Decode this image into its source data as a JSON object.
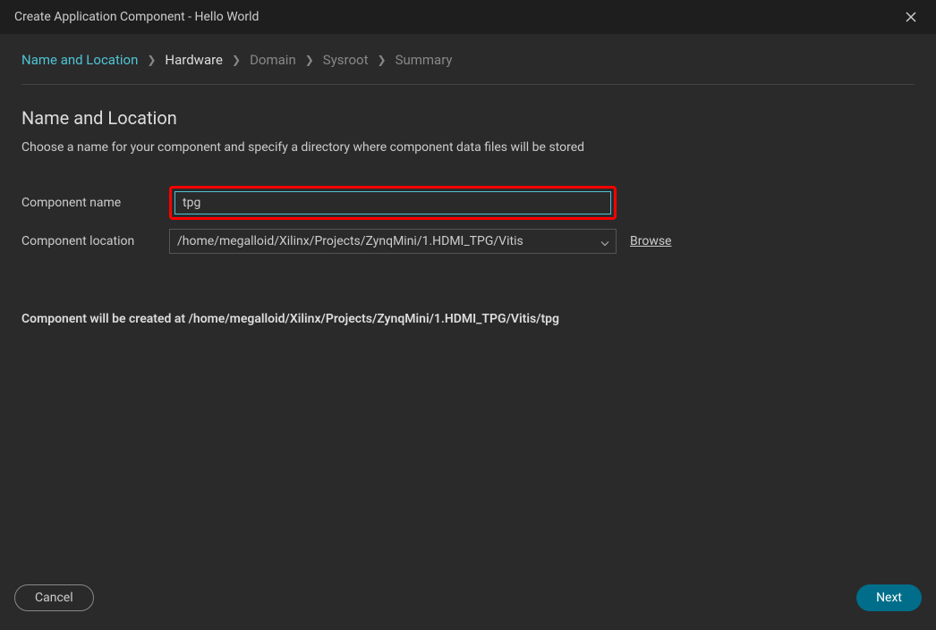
{
  "titlebar": {
    "title": "Create Application Component - Hello World"
  },
  "breadcrumb": {
    "items": [
      {
        "label": "Name and Location",
        "state": "active"
      },
      {
        "label": "Hardware",
        "state": "enabled"
      },
      {
        "label": "Domain",
        "state": "disabled"
      },
      {
        "label": "Sysroot",
        "state": "disabled"
      },
      {
        "label": "Summary",
        "state": "disabled"
      }
    ]
  },
  "section": {
    "title": "Name and Location",
    "subtitle": "Choose a name for your component and specify a directory where component data files will be stored"
  },
  "form": {
    "name_label": "Component name",
    "name_value": "tpg",
    "location_label": "Component location",
    "location_value": "/home/megalloid/Xilinx/Projects/ZynqMini/1.HDMI_TPG/Vitis",
    "browse_label": "Browse",
    "created_at_label": "Component will be created at ",
    "created_at_path": "/home/megalloid/Xilinx/Projects/ZynqMini/1.HDMI_TPG/Vitis/tpg"
  },
  "footer": {
    "cancel_label": "Cancel",
    "next_label": "Next"
  }
}
